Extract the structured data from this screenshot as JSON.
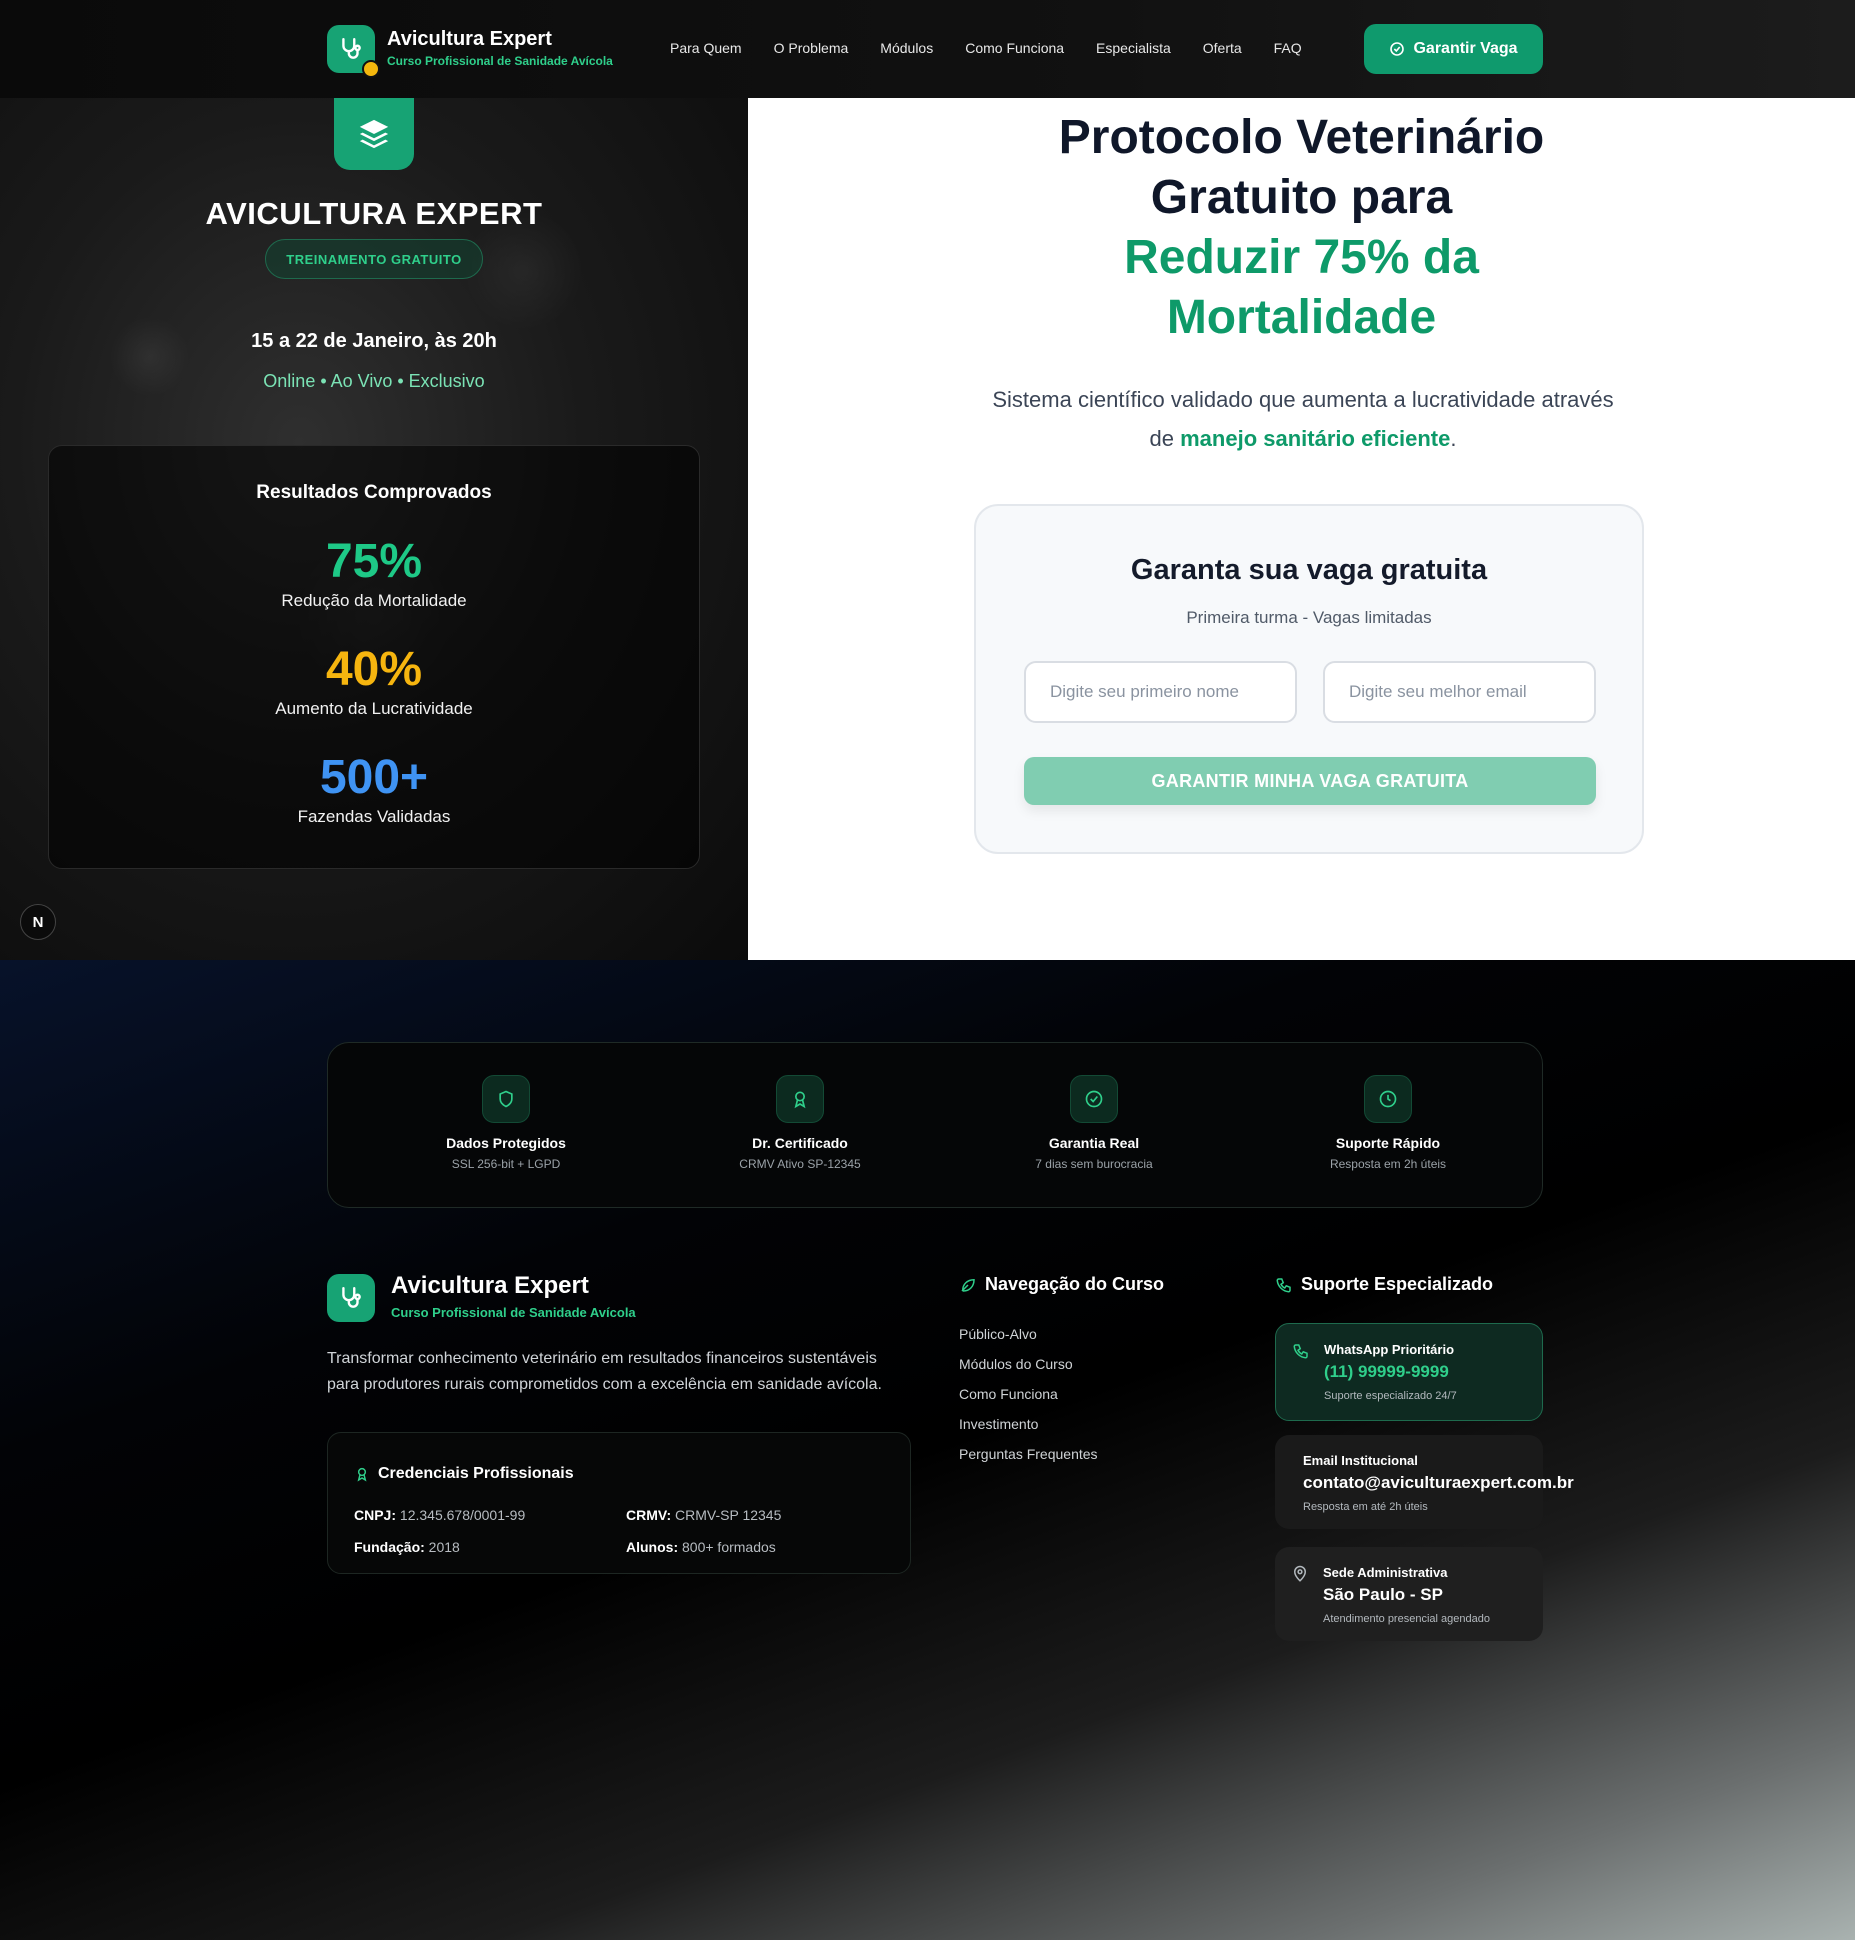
{
  "nav": {
    "brand_title": "Avicultura Expert",
    "brand_subtitle": "Curso Profissional de Sanidade Avícola",
    "links": [
      "Para Quem",
      "O Problema",
      "Módulos",
      "Como Funciona",
      "Especialista",
      "Oferta",
      "FAQ"
    ],
    "cta_label": "Garantir Vaga"
  },
  "hero_left": {
    "icon": "layers-icon",
    "title": "AVICULTURA EXPERT",
    "badge": "TREINAMENTO GRATUITO",
    "date": "15 a 22 de Janeiro, às 20h",
    "mode": "Online • Ao Vivo • Exclusivo",
    "results_title": "Resultados Comprovados",
    "stats": [
      {
        "value": "75%",
        "label": "Redução da Mortalidade",
        "color": "#1ec987"
      },
      {
        "value": "40%",
        "label": "Aumento da Lucratividade",
        "color": "#f6b50f"
      },
      {
        "value": "500+",
        "label": "Fazendas Validadas",
        "color": "#3f93f3"
      }
    ],
    "corner_badge": "N"
  },
  "hero_right": {
    "title_line1": "Protocolo Veterinário",
    "title_line2": "Gratuito para",
    "title_line3": "Reduzir 75% da",
    "title_line4": "Mortalidade",
    "subtitle_pre": "Sistema científico validado que aumenta a lucratividade através de ",
    "subtitle_highlight": "manejo sanitário eficiente",
    "subtitle_post": ".",
    "form": {
      "title": "Garanta sua vaga gratuita",
      "subtitle": "Primeira turma - Vagas limitadas",
      "name_placeholder": "Digite seu primeiro nome",
      "email_placeholder": "Digite seu melhor email",
      "submit_label": "GARANTIR MINHA VAGA GRATUITA"
    }
  },
  "trust": [
    {
      "icon": "shield-icon",
      "title": "Dados Protegidos",
      "subtitle": "SSL 256-bit + LGPD"
    },
    {
      "icon": "award-icon",
      "title": "Dr. Certificado",
      "subtitle": "CRMV Ativo SP-12345"
    },
    {
      "icon": "check-circle-icon",
      "title": "Garantia Real",
      "subtitle": "7 dias sem burocracia"
    },
    {
      "icon": "clock-icon",
      "title": "Suporte Rápido",
      "subtitle": "Resposta em 2h úteis"
    }
  ],
  "footer": {
    "brand_title": "Avicultura Expert",
    "brand_subtitle": "Curso Profissional de Sanidade Avícola",
    "description": "Transformar conhecimento veterinário em resultados financeiros sustentáveis para produtores rurais comprometidos com a excelência em sanidade avícola.",
    "credentials_title": "Credenciais Profissionais",
    "credentials": [
      {
        "label": "CNPJ:",
        "value": "12.345.678/0001-99"
      },
      {
        "label": "CRMV:",
        "value": "CRMV-SP 12345"
      },
      {
        "label": "Fundação:",
        "value": "2018"
      },
      {
        "label": "Alunos:",
        "value": "800+ formados"
      }
    ],
    "nav_title": "Navegação do Curso",
    "nav_links": [
      "Público-Alvo",
      "Módulos do Curso",
      "Como Funciona",
      "Investimento",
      "Perguntas Frequentes"
    ],
    "support_title": "Suporte Especializado",
    "support": [
      {
        "title": "WhatsApp Prioritário",
        "value": "(11) 99999-9999",
        "subtitle": "Suporte especializado 24/7",
        "icon": "phone-icon"
      },
      {
        "title": "Email Institucional",
        "value": "contato@aviculturaexpert.com.br",
        "subtitle": "Resposta em até 2h úteis",
        "icon": "mail-icon"
      },
      {
        "title": "Sede Administrativa",
        "value": "São Paulo - SP",
        "subtitle": "Atendimento presencial agendado",
        "icon": "map-pin-icon"
      }
    ]
  }
}
